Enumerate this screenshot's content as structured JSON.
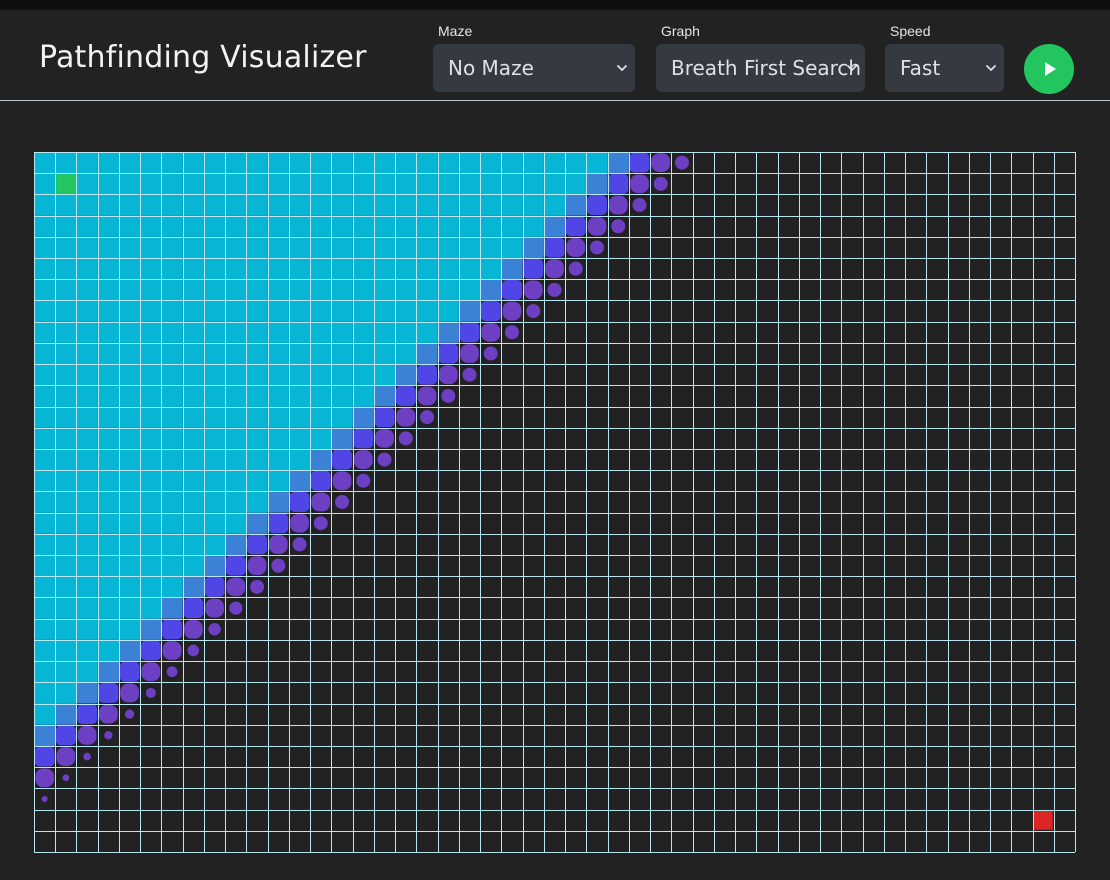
{
  "header": {
    "title": "Pathfinding Visualizer"
  },
  "controls": {
    "maze": {
      "label": "Maze",
      "value": "No Maze"
    },
    "graph": {
      "label": "Graph",
      "value": "Breath First Search"
    },
    "speed": {
      "label": "Speed",
      "value": "Fast"
    }
  },
  "run_button": {
    "icon": "play-icon",
    "color": "#22c55e"
  },
  "grid": {
    "cols": 49,
    "rows": 33,
    "start_node": {
      "col": 1,
      "row": 1,
      "color": "#22c55e"
    },
    "end_node": {
      "col": 47,
      "row": 31,
      "color": "#dc2626"
    },
    "colors": {
      "background": "#222222",
      "grid_lines": "#b9e6ef",
      "visited": "#06b6d4",
      "frontier_light": "#22d3ee",
      "frontier_mid": "#3b82d6",
      "frontier_dark": "#4f46e5",
      "frontier_purple": "#6d3fc2"
    }
  }
}
